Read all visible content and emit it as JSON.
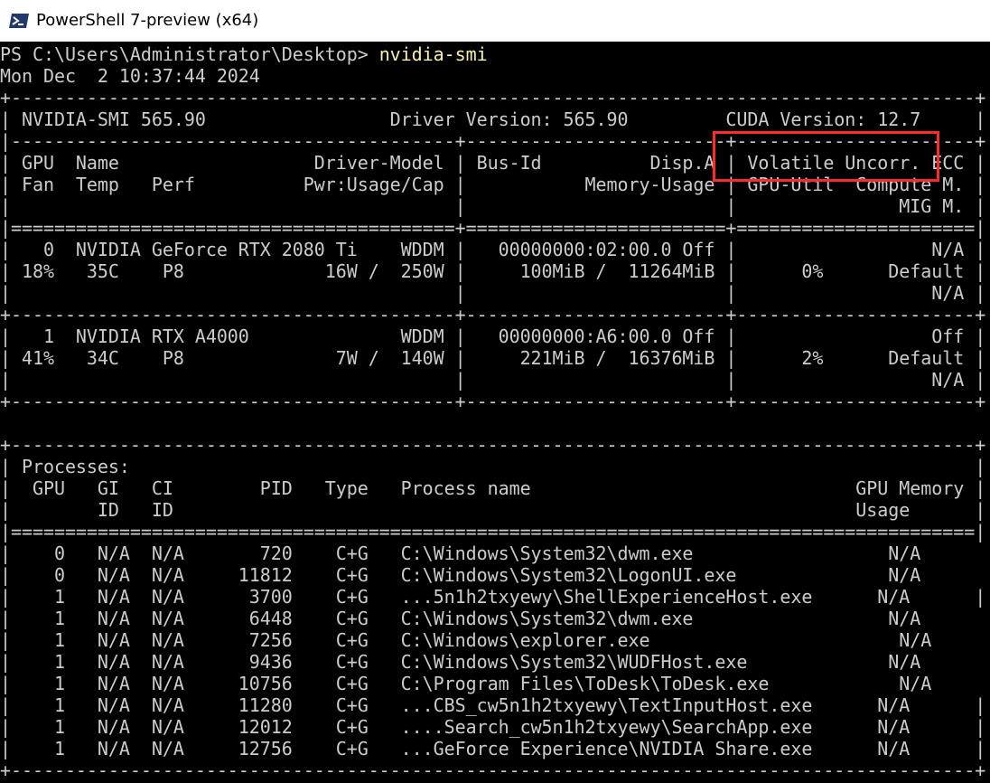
{
  "window": {
    "title": "PowerShell 7-preview (x64)",
    "icon": "powershell-icon"
  },
  "prompt": {
    "path": "PS C:\\Users\\Administrator\\Desktop> ",
    "command": "nvidia-smi"
  },
  "timestamp": "Mon Dec  2 10:37:44 2024",
  "highlight": {
    "label": "CUDA Version: 12.7",
    "color": "#ff2a2a"
  },
  "colors": {
    "background": "#000000",
    "text": "#cccccc",
    "command": "#f9f1a5"
  },
  "output": {
    "summary": [
      "+-----------------------------------------------------------------------------------------+",
      "| NVIDIA-SMI 565.90                 Driver Version: 565.90         CUDA Version: 12.7     |",
      "|-----------------------------------------+------------------------+----------------------+",
      "| GPU  Name                  Driver-Model | Bus-Id          Disp.A | Volatile Uncorr. ECC |",
      "| Fan  Temp   Perf          Pwr:Usage/Cap |           Memory-Usage | GPU-Util  Compute M. |",
      "|                                         |                        |               MIG M. |",
      "|=========================================+========================+======================|",
      "|   0  NVIDIA GeForce RTX 2080 Ti    WDDM |   00000000:02:00.0 Off |                  N/A |",
      "| 18%   35C    P8             16W /  250W |     100MiB /  11264MiB |      0%      Default |",
      "|                                         |                        |                  N/A |",
      "+-----------------------------------------+------------------------+----------------------+",
      "|   1  NVIDIA RTX A4000              WDDM |   00000000:A6:00.0 Off |                  Off |",
      "| 41%   34C    P8              7W /  140W |     221MiB /  16376MiB |      2%      Default |",
      "|                                         |                        |                  N/A |",
      "+-----------------------------------------+------------------------+----------------------+"
    ],
    "processes": [
      "+-----------------------------------------------------------------------------------------+",
      "| Processes:                                                                              |",
      "|  GPU   GI   CI        PID   Type   Process name                              GPU Memory |",
      "|        ID   ID                                                               Usage      |",
      "|=========================================================================================|",
      "|    0   N/A  N/A       720    C+G   C:\\Windows\\System32\\dwm.exe                  N/A      |",
      "|    0   N/A  N/A     11812    C+G   C:\\Windows\\System32\\LogonUI.exe              N/A      |",
      "|    1   N/A  N/A      3700    C+G   ...5n1h2txyewy\\ShellExperienceHost.exe      N/A      |",
      "|    1   N/A  N/A      6448    C+G   C:\\Windows\\System32\\dwm.exe                  N/A      |",
      "|    1   N/A  N/A      7256    C+G   C:\\Windows\\explorer.exe                       N/A      |",
      "|    1   N/A  N/A      9436    C+G   C:\\Windows\\System32\\WUDFHost.exe             N/A      |",
      "|    1   N/A  N/A     10756    C+G   C:\\Program Files\\ToDesk\\ToDesk.exe            N/A      |",
      "|    1   N/A  N/A     11280    C+G   ...CBS_cw5n1h2txyewy\\TextInputHost.exe      N/A      |",
      "|    1   N/A  N/A     12012    C+G   ....Search_cw5n1h2txyewy\\SearchApp.exe      N/A      |",
      "|    1   N/A  N/A     12756    C+G   ...GeForce Experience\\NVIDIA Share.exe      N/A      |",
      "+-----------------------------------------------------------------------------------------+"
    ]
  }
}
